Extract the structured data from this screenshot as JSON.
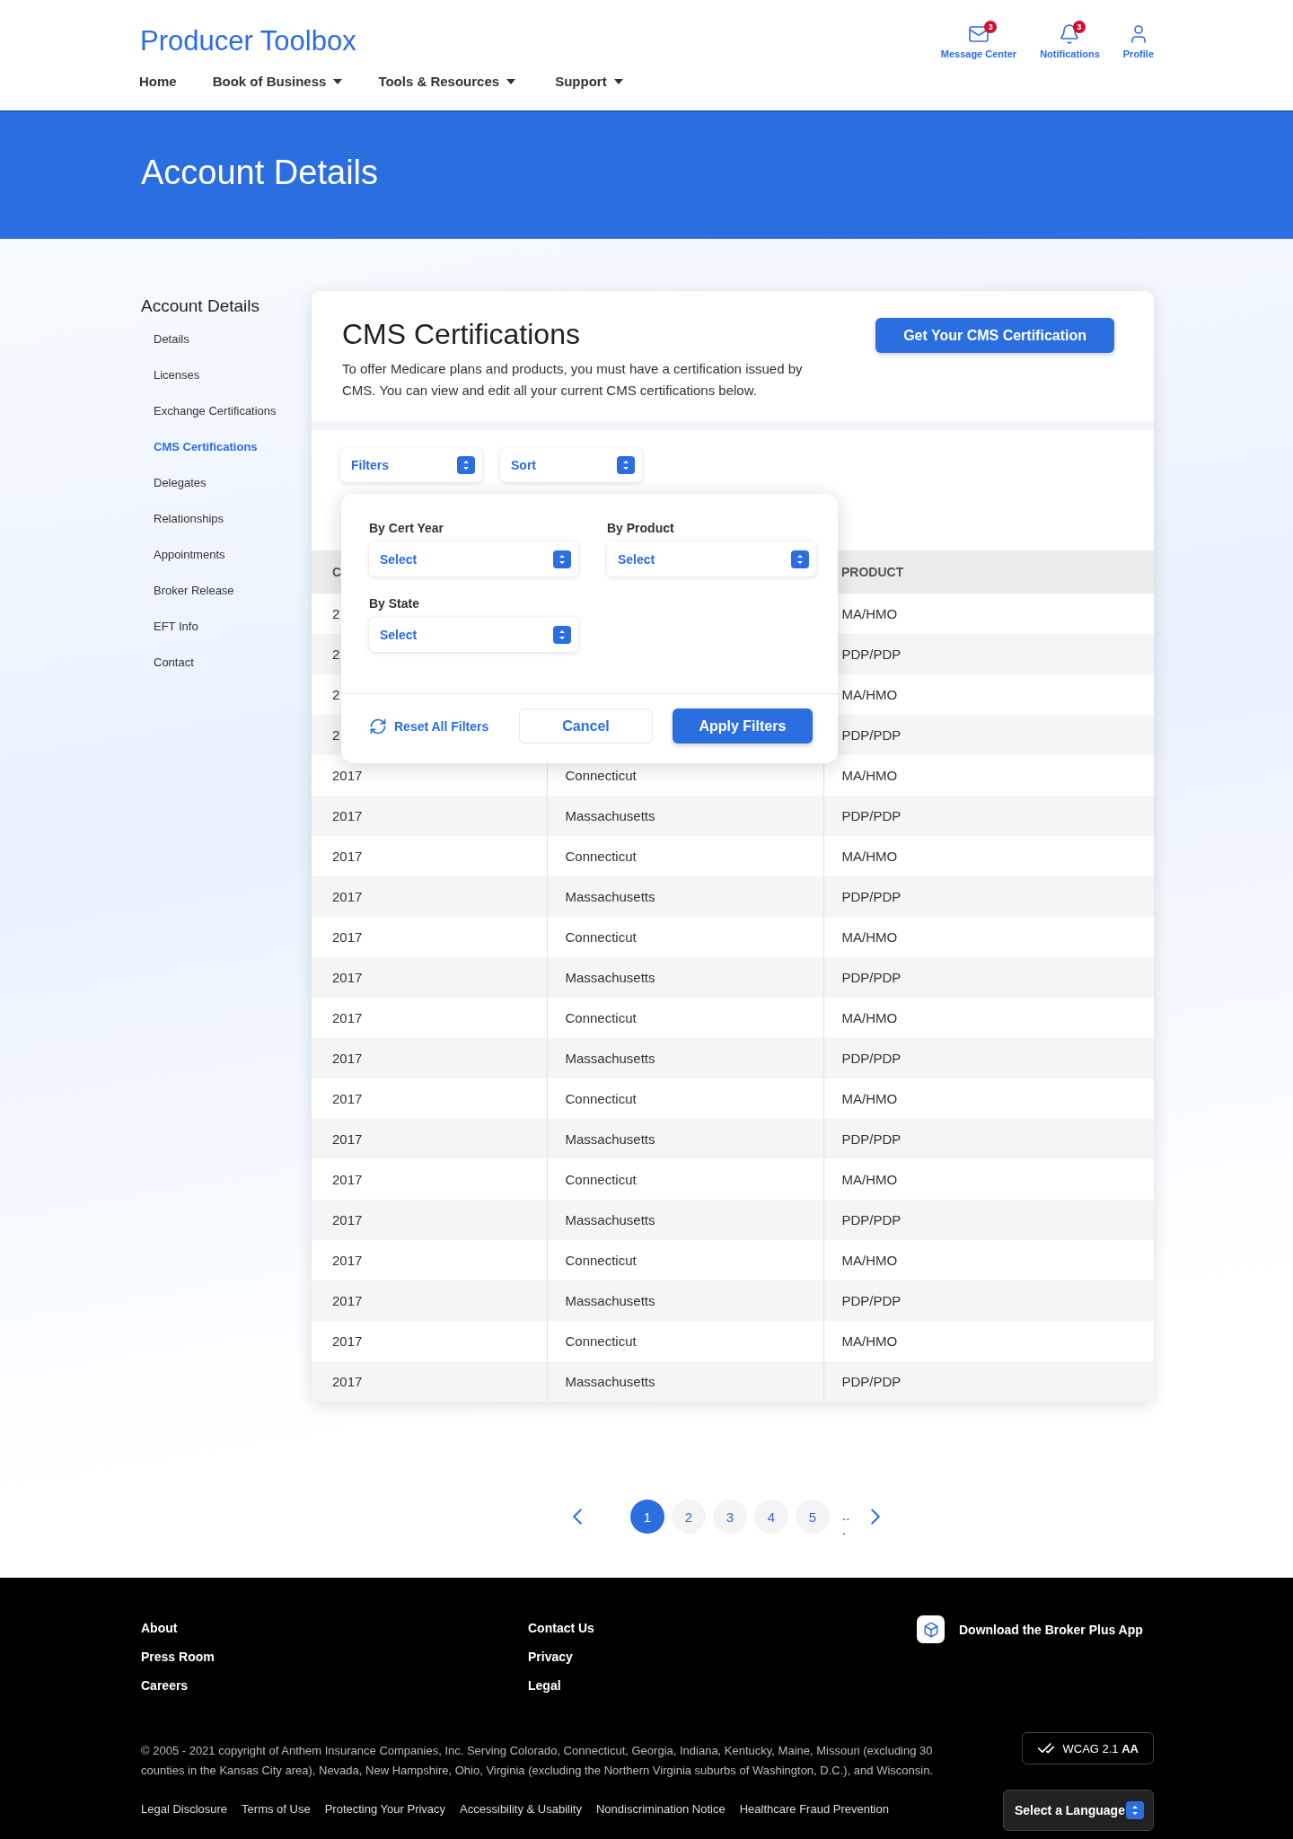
{
  "brand": "Producer Toolbox",
  "nav": [
    {
      "label": "Home",
      "dropdown": false
    },
    {
      "label": "Book of Business",
      "dropdown": true
    },
    {
      "label": "Tools & Resources",
      "dropdown": true
    },
    {
      "label": "Support",
      "dropdown": true
    }
  ],
  "header_actions": [
    {
      "kind": "mail",
      "label": "Message Center",
      "badge": "3"
    },
    {
      "kind": "bell",
      "label": "Notifications",
      "badge": "3"
    },
    {
      "kind": "user",
      "label": "Profile"
    }
  ],
  "page_title": "Account Details",
  "sidebar": {
    "title": "Account Details",
    "items": [
      {
        "label": "Details",
        "selected": false
      },
      {
        "label": "Licenses",
        "selected": false
      },
      {
        "label": "Exchange Certifications",
        "selected": false
      },
      {
        "label": "CMS Certifications",
        "selected": true
      },
      {
        "label": "Delegates",
        "selected": false
      },
      {
        "label": "Relationships",
        "selected": false
      },
      {
        "label": "Appointments",
        "selected": false
      },
      {
        "label": "Broker Release",
        "selected": false
      },
      {
        "label": "EFT Info",
        "selected": false
      },
      {
        "label": "Contact",
        "selected": false
      }
    ]
  },
  "card": {
    "title": "CMS Certifications",
    "description": "To offer Medicare plans and products, you must have a certification issued by CMS. You can view and edit all your current CMS certifications below.",
    "action": "Get Your CMS Certification"
  },
  "toolbar": [
    {
      "label": "Filters"
    },
    {
      "label": "Sort"
    }
  ],
  "filter_panel": {
    "fields": [
      {
        "label": "By Cert Year",
        "value": "Select"
      },
      {
        "label": "By Product",
        "value": "Select"
      },
      {
        "label": "By State",
        "value": "Select"
      }
    ],
    "reset": "Reset All Filters",
    "cancel": "Cancel",
    "apply": "Apply Filters"
  },
  "table": {
    "columns": {
      "column_1": "C",
      "product": "PRODUCT"
    },
    "rows": [
      {
        "column_1": "2",
        "product": "MA/HMO"
      },
      {
        "column_1": "2",
        "product": "PDP/PDP"
      },
      {
        "column_1": "2",
        "product": "MA/HMO"
      },
      {
        "column_1": "2",
        "product": "PDP/PDP"
      },
      {
        "column_1": "2017",
        "column_2": "Connecticut",
        "product": "MA/HMO"
      },
      {
        "column_1": "2017",
        "column_2": "Massachusetts",
        "product": "PDP/PDP"
      },
      {
        "column_1": "2017",
        "column_2": "Connecticut",
        "product": "MA/HMO"
      },
      {
        "column_1": "2017",
        "column_2": "Massachusetts",
        "product": "PDP/PDP"
      },
      {
        "column_1": "2017",
        "column_2": "Connecticut",
        "product": "MA/HMO"
      },
      {
        "column_1": "2017",
        "column_2": "Massachusetts",
        "product": "PDP/PDP"
      },
      {
        "column_1": "2017",
        "column_2": "Connecticut",
        "product": "MA/HMO"
      },
      {
        "column_1": "2017",
        "column_2": "Massachusetts",
        "product": "PDP/PDP"
      },
      {
        "column_1": "2017",
        "column_2": "Connecticut",
        "product": "MA/HMO"
      },
      {
        "column_1": "2017",
        "column_2": "Massachusetts",
        "product": "PDP/PDP"
      },
      {
        "column_1": "2017",
        "column_2": "Connecticut",
        "product": "MA/HMO"
      },
      {
        "column_1": "2017",
        "column_2": "Massachusetts",
        "product": "PDP/PDP"
      },
      {
        "column_1": "2017",
        "column_2": "Connecticut",
        "product": "MA/HMO"
      },
      {
        "column_1": "2017",
        "column_2": "Massachusetts",
        "product": "PDP/PDP"
      },
      {
        "column_1": "2017",
        "column_2": "Connecticut",
        "product": "MA/HMO"
      },
      {
        "column_1": "2017",
        "column_2": "Massachusetts",
        "product": "PDP/PDP"
      }
    ]
  },
  "pagination": {
    "pages": [
      {
        "label": "1",
        "selected": true
      },
      {
        "label": "2",
        "selected": false
      },
      {
        "label": "3",
        "selected": false
      },
      {
        "label": "4",
        "selected": false
      },
      {
        "label": "5",
        "selected": false
      }
    ],
    "ellipsis": "..."
  },
  "footer": {
    "columns": [
      [
        "About",
        "Press Room",
        "Careers"
      ],
      [
        "Contact Us",
        "Privacy",
        "Legal"
      ]
    ],
    "app_link": "Download the Broker Plus App",
    "copyright": "© 2005 - 2021 copyright of Anthem Insurance Companies, Inc. Serving Colorado, Connecticut, Georgia, Indiana, Kentucky, Maine, Missouri (excluding 30 counties in the Kansas City area), Nevada, New Hampshire, Ohio, Virginia (excluding the Northern Virginia suburbs of Washington, D.C.), and Wisconsin.",
    "badge": {
      "text": "WCAG 2.1 ",
      "strong": "AA"
    },
    "legal_links": [
      "Legal Disclosure",
      "Terms of Use",
      "Protecting Your Privacy",
      "Accessibility & Usability",
      "Nondiscrimination Notice",
      "Healthcare Fraud Prevention"
    ],
    "language": "Select a Language"
  }
}
